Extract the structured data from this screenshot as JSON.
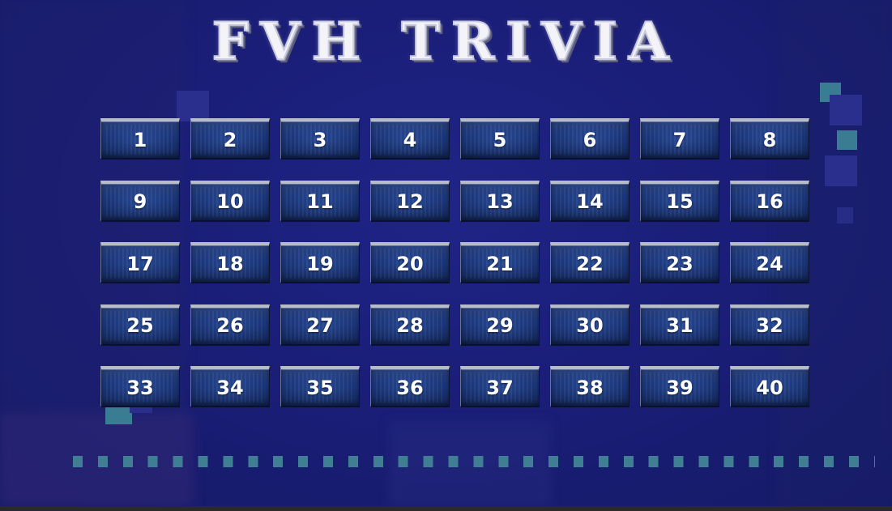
{
  "title": "FVH TRIVIA",
  "board": {
    "tiles": [
      "1",
      "2",
      "3",
      "4",
      "5",
      "6",
      "7",
      "8",
      "9",
      "10",
      "11",
      "12",
      "13",
      "14",
      "15",
      "16",
      "17",
      "18",
      "19",
      "20",
      "21",
      "22",
      "23",
      "24",
      "25",
      "26",
      "27",
      "28",
      "29",
      "30",
      "31",
      "32",
      "33",
      "34",
      "35",
      "36",
      "37",
      "38",
      "39",
      "40"
    ]
  },
  "colors": {
    "background": "#1a1d6e",
    "tile": "#1d3a82",
    "tile_top_edge": "#b8bcc8",
    "accent_teal": "#3f7e93",
    "text": "#ffffff"
  }
}
